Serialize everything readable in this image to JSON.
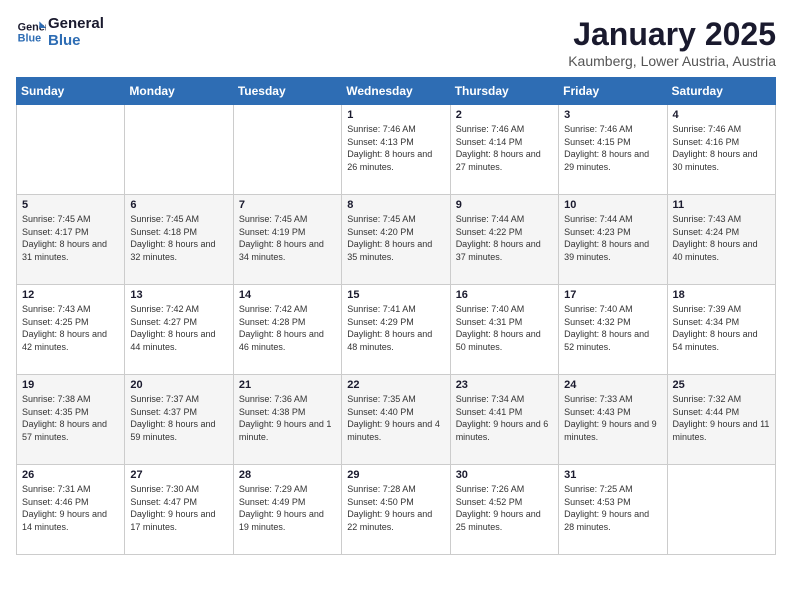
{
  "header": {
    "logo_line1": "General",
    "logo_line2": "Blue",
    "month": "January 2025",
    "location": "Kaumberg, Lower Austria, Austria"
  },
  "days_of_week": [
    "Sunday",
    "Monday",
    "Tuesday",
    "Wednesday",
    "Thursday",
    "Friday",
    "Saturday"
  ],
  "weeks": [
    [
      {
        "day": "",
        "content": ""
      },
      {
        "day": "",
        "content": ""
      },
      {
        "day": "",
        "content": ""
      },
      {
        "day": "1",
        "content": "Sunrise: 7:46 AM\nSunset: 4:13 PM\nDaylight: 8 hours and 26 minutes."
      },
      {
        "day": "2",
        "content": "Sunrise: 7:46 AM\nSunset: 4:14 PM\nDaylight: 8 hours and 27 minutes."
      },
      {
        "day": "3",
        "content": "Sunrise: 7:46 AM\nSunset: 4:15 PM\nDaylight: 8 hours and 29 minutes."
      },
      {
        "day": "4",
        "content": "Sunrise: 7:46 AM\nSunset: 4:16 PM\nDaylight: 8 hours and 30 minutes."
      }
    ],
    [
      {
        "day": "5",
        "content": "Sunrise: 7:45 AM\nSunset: 4:17 PM\nDaylight: 8 hours and 31 minutes."
      },
      {
        "day": "6",
        "content": "Sunrise: 7:45 AM\nSunset: 4:18 PM\nDaylight: 8 hours and 32 minutes."
      },
      {
        "day": "7",
        "content": "Sunrise: 7:45 AM\nSunset: 4:19 PM\nDaylight: 8 hours and 34 minutes."
      },
      {
        "day": "8",
        "content": "Sunrise: 7:45 AM\nSunset: 4:20 PM\nDaylight: 8 hours and 35 minutes."
      },
      {
        "day": "9",
        "content": "Sunrise: 7:44 AM\nSunset: 4:22 PM\nDaylight: 8 hours and 37 minutes."
      },
      {
        "day": "10",
        "content": "Sunrise: 7:44 AM\nSunset: 4:23 PM\nDaylight: 8 hours and 39 minutes."
      },
      {
        "day": "11",
        "content": "Sunrise: 7:43 AM\nSunset: 4:24 PM\nDaylight: 8 hours and 40 minutes."
      }
    ],
    [
      {
        "day": "12",
        "content": "Sunrise: 7:43 AM\nSunset: 4:25 PM\nDaylight: 8 hours and 42 minutes."
      },
      {
        "day": "13",
        "content": "Sunrise: 7:42 AM\nSunset: 4:27 PM\nDaylight: 8 hours and 44 minutes."
      },
      {
        "day": "14",
        "content": "Sunrise: 7:42 AM\nSunset: 4:28 PM\nDaylight: 8 hours and 46 minutes."
      },
      {
        "day": "15",
        "content": "Sunrise: 7:41 AM\nSunset: 4:29 PM\nDaylight: 8 hours and 48 minutes."
      },
      {
        "day": "16",
        "content": "Sunrise: 7:40 AM\nSunset: 4:31 PM\nDaylight: 8 hours and 50 minutes."
      },
      {
        "day": "17",
        "content": "Sunrise: 7:40 AM\nSunset: 4:32 PM\nDaylight: 8 hours and 52 minutes."
      },
      {
        "day": "18",
        "content": "Sunrise: 7:39 AM\nSunset: 4:34 PM\nDaylight: 8 hours and 54 minutes."
      }
    ],
    [
      {
        "day": "19",
        "content": "Sunrise: 7:38 AM\nSunset: 4:35 PM\nDaylight: 8 hours and 57 minutes."
      },
      {
        "day": "20",
        "content": "Sunrise: 7:37 AM\nSunset: 4:37 PM\nDaylight: 8 hours and 59 minutes."
      },
      {
        "day": "21",
        "content": "Sunrise: 7:36 AM\nSunset: 4:38 PM\nDaylight: 9 hours and 1 minute."
      },
      {
        "day": "22",
        "content": "Sunrise: 7:35 AM\nSunset: 4:40 PM\nDaylight: 9 hours and 4 minutes."
      },
      {
        "day": "23",
        "content": "Sunrise: 7:34 AM\nSunset: 4:41 PM\nDaylight: 9 hours and 6 minutes."
      },
      {
        "day": "24",
        "content": "Sunrise: 7:33 AM\nSunset: 4:43 PM\nDaylight: 9 hours and 9 minutes."
      },
      {
        "day": "25",
        "content": "Sunrise: 7:32 AM\nSunset: 4:44 PM\nDaylight: 9 hours and 11 minutes."
      }
    ],
    [
      {
        "day": "26",
        "content": "Sunrise: 7:31 AM\nSunset: 4:46 PM\nDaylight: 9 hours and 14 minutes."
      },
      {
        "day": "27",
        "content": "Sunrise: 7:30 AM\nSunset: 4:47 PM\nDaylight: 9 hours and 17 minutes."
      },
      {
        "day": "28",
        "content": "Sunrise: 7:29 AM\nSunset: 4:49 PM\nDaylight: 9 hours and 19 minutes."
      },
      {
        "day": "29",
        "content": "Sunrise: 7:28 AM\nSunset: 4:50 PM\nDaylight: 9 hours and 22 minutes."
      },
      {
        "day": "30",
        "content": "Sunrise: 7:26 AM\nSunset: 4:52 PM\nDaylight: 9 hours and 25 minutes."
      },
      {
        "day": "31",
        "content": "Sunrise: 7:25 AM\nSunset: 4:53 PM\nDaylight: 9 hours and 28 minutes."
      },
      {
        "day": "",
        "content": ""
      }
    ]
  ]
}
